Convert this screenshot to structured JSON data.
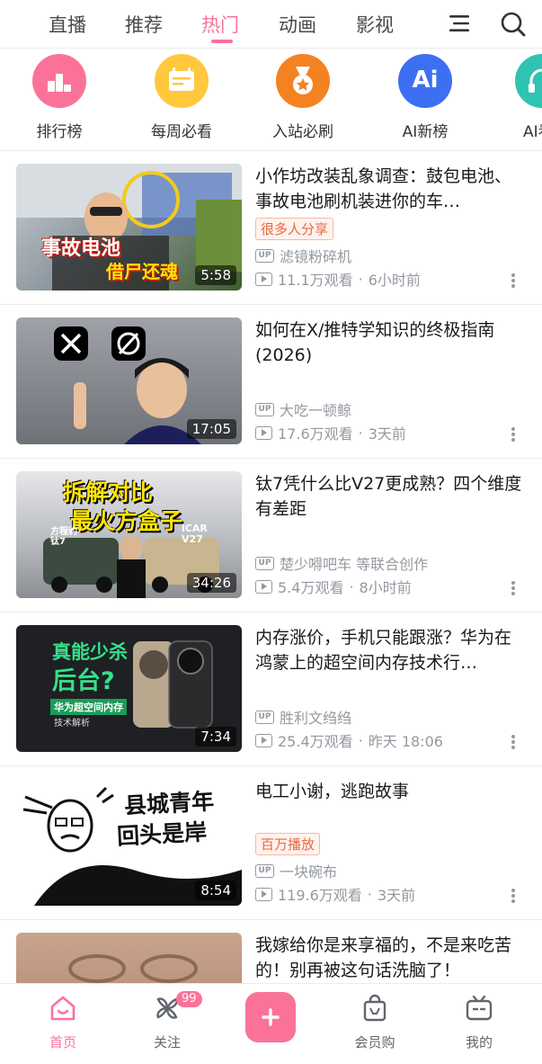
{
  "top_tabs": {
    "items": [
      "直播",
      "推荐",
      "热门",
      "动画",
      "影视"
    ],
    "active": "热门"
  },
  "quick_entries": [
    {
      "label": "排行榜",
      "color": "#fb7299",
      "icon": "ranking-icon"
    },
    {
      "label": "每周必看",
      "color": "#ffc83d",
      "icon": "calendar-icon"
    },
    {
      "label": "入站必刷",
      "color": "#f58220",
      "icon": "medal-icon"
    },
    {
      "label": "AI新榜",
      "color": "#3d6ff2",
      "icon": "ai-icon",
      "text": "Ai"
    },
    {
      "label": "AI看",
      "color": "#2fc4b2",
      "icon": "ai-headphone-icon"
    }
  ],
  "videos": [
    {
      "title": "小作坊改装乱象调查：鼓包电池、事故电池刷机装进你的车…",
      "tag": "很多人分享",
      "uploader": "滤镜粉碎机",
      "views": "11.1万观看",
      "time": "6小时前",
      "duration": "5:58",
      "thumb_text": [
        "事故电池",
        "借尸还魂"
      ]
    },
    {
      "title": "如何在X/推特学知识的终极指南(2026)",
      "tag": "",
      "uploader": "大吃一顿鲸",
      "views": "17.6万观看",
      "time": "3天前",
      "duration": "17:05",
      "thumb_text": []
    },
    {
      "title": "钛7凭什么比V27更成熟？四个维度有差距",
      "tag": "",
      "uploader": "楚少嘚吧车 等联合创作",
      "views": "5.4万观看",
      "time": "8小时前",
      "duration": "34:26",
      "thumb_text": [
        "拆解对比",
        "最火方盒子",
        "方程豹钛7",
        "iCAR V27"
      ]
    },
    {
      "title": "内存涨价，手机只能跟涨？华为在鸿蒙上的超空间内存技术行…",
      "tag": "",
      "uploader": "胜利文绉绉",
      "views": "25.4万观看",
      "time": "昨天 18:06",
      "duration": "7:34",
      "thumb_text": [
        "真能少杀",
        "后台?",
        "华为超空间内存",
        "技术解析"
      ]
    },
    {
      "title": "电工小谢，逃跑故事",
      "tag": "百万播放",
      "uploader": "一块碗布",
      "views": "119.6万观看",
      "time": "3天前",
      "duration": "8:54",
      "thumb_text": [
        "县城青年",
        "回头是岸"
      ]
    },
    {
      "title": "我嫁给你是来享福的，不是来吃苦的！别再被这句话洗脑了！",
      "tag": "",
      "uploader": "",
      "views": "",
      "time": "",
      "duration": "",
      "thumb_text": []
    }
  ],
  "bottom_nav": {
    "items": [
      "首页",
      "关注",
      "会员购",
      "我的"
    ],
    "badge": "99",
    "active": "首页"
  },
  "colors": {
    "accent": "#fb7299",
    "meta": "#9499a0"
  }
}
